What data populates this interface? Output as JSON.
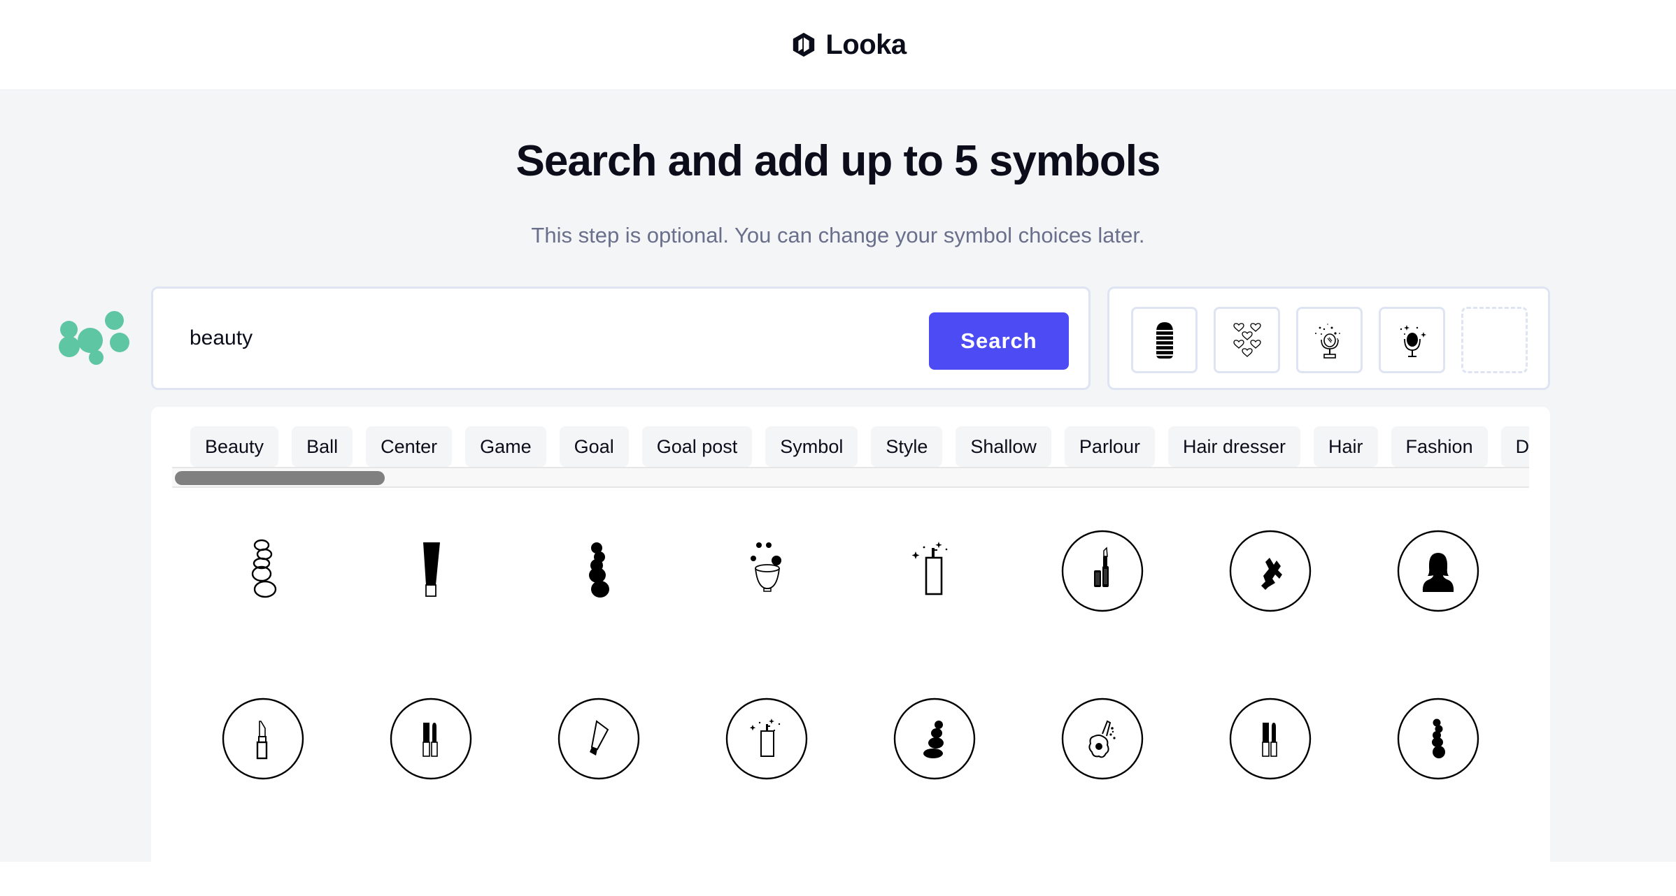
{
  "brand": {
    "name": "Looka",
    "logo_icon": "hexagon-logo-icon"
  },
  "header": {
    "title": "Search and add up to 5 symbols",
    "subtitle": "This step is optional. You can change your symbol choices later."
  },
  "decoration": {
    "icon": "bubbles-icon",
    "color": "#5ec6a3"
  },
  "search": {
    "value": "beauty",
    "placeholder": "",
    "button_label": "Search",
    "button_color": "#4c4bf4"
  },
  "selected_symbols": {
    "max": 5,
    "slots": [
      {
        "icon": "striped-nail-icon",
        "filled": true
      },
      {
        "icon": "hearts-icon",
        "filled": true
      },
      {
        "icon": "vanity-mirror-sparkle-icon",
        "filled": true
      },
      {
        "icon": "hand-mirror-sparkle-icon",
        "filled": true
      },
      {
        "icon": "empty-slot",
        "filled": false
      }
    ]
  },
  "tags": [
    "Beauty",
    "Ball",
    "Center",
    "Game",
    "Goal",
    "Goal post",
    "Symbol",
    "Style",
    "Shallow",
    "Parlour",
    "Hair dresser",
    "Hair",
    "Fashion",
    "Dryer"
  ],
  "results": {
    "rows": [
      [
        {
          "icon": "stacked-stones-outline-icon",
          "circled": false
        },
        {
          "icon": "cream-tube-icon",
          "circled": false
        },
        {
          "icon": "stacked-stones-filled-icon",
          "circled": false
        },
        {
          "icon": "flower-bowl-icon",
          "circled": false
        },
        {
          "icon": "perfume-spray-sparkle-icon",
          "circled": false
        },
        {
          "icon": "lipstick-nail-polish-icon",
          "circled": true
        },
        {
          "icon": "hair-comb-icon",
          "circled": true
        },
        {
          "icon": "woman-silhouette-icon",
          "circled": true
        }
      ],
      [
        {
          "icon": "lipstick-icon",
          "circled": true
        },
        {
          "icon": "lipstick-pair-icon",
          "circled": true
        },
        {
          "icon": "tilted-tube-icon",
          "circled": true
        },
        {
          "icon": "perfume-spray-sparkle-icon",
          "circled": true
        },
        {
          "icon": "balanced-stones-icon",
          "circled": true
        },
        {
          "icon": "hair-dryer-icon",
          "circled": true
        },
        {
          "icon": "lipstick-pair-icon",
          "circled": true
        },
        {
          "icon": "stacked-stones-filled-icon",
          "circled": true
        }
      ]
    ]
  }
}
